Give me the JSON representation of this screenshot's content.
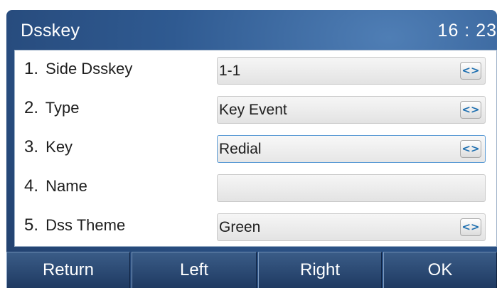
{
  "header": {
    "title": "Dsskey",
    "time": "16 : 23"
  },
  "rows": [
    {
      "number": "1.",
      "label": "Side Dsskey",
      "value": "1-1",
      "switch_icon": "left-right-arrows"
    },
    {
      "number": "2.",
      "label": "Type",
      "value": "Key Event",
      "switch_icon": "left-right-arrows"
    },
    {
      "number": "3.",
      "label": "Key",
      "value": "Redial",
      "switch_icon": "left-right-arrows"
    },
    {
      "number": "4.",
      "label": "Name",
      "value": ""
    },
    {
      "number": "5.",
      "label": "Dss Theme",
      "value": "Green",
      "switch_icon": "left-right-arrows"
    }
  ],
  "switch_glyph": "<>",
  "softkeys": {
    "return": "Return",
    "left": "Left",
    "right": "Right",
    "ok": "OK"
  },
  "colors": {
    "accent": "#5a9ad4",
    "background": "#2f5a91",
    "panel": "#ffffff"
  }
}
